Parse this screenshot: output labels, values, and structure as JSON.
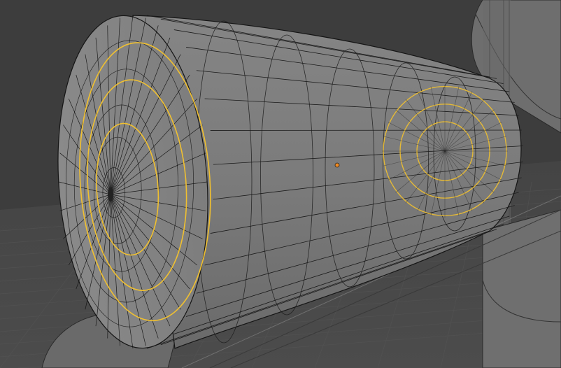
{
  "viewport": {
    "mode": "edit-mode-wireframe-overlay",
    "background_color": "#3d3d3d",
    "mesh_fill_color": "#7a7a7a",
    "edge_color": "#111111",
    "selection_color": "#f0c030",
    "origin_color": "#f08a20"
  },
  "objects": [
    {
      "name": "cylinder-mesh",
      "selected_edge_loops_front": 3,
      "selected_edge_loops_back": 3
    },
    {
      "name": "background-mesh"
    }
  ]
}
